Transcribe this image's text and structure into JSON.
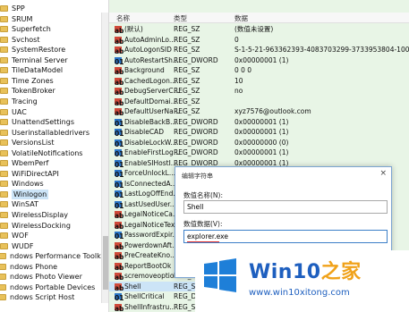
{
  "tree": {
    "items": [
      {
        "label": "SPP",
        "selected": false
      },
      {
        "label": "SRUM",
        "selected": false
      },
      {
        "label": "Superfetch",
        "selected": false
      },
      {
        "label": "Svchost",
        "selected": false
      },
      {
        "label": "SystemRestore",
        "selected": false
      },
      {
        "label": "Terminal Server",
        "selected": false
      },
      {
        "label": "TileDataModel",
        "selected": false
      },
      {
        "label": "Time Zones",
        "selected": false
      },
      {
        "label": "TokenBroker",
        "selected": false
      },
      {
        "label": "Tracing",
        "selected": false
      },
      {
        "label": "UAC",
        "selected": false
      },
      {
        "label": "UnattendSettings",
        "selected": false
      },
      {
        "label": "Userinstallabledrivers",
        "selected": false
      },
      {
        "label": "VersionsList",
        "selected": false
      },
      {
        "label": "VolatileNotifications",
        "selected": false
      },
      {
        "label": "WbemPerf",
        "selected": false
      },
      {
        "label": "WiFiDirectAPI",
        "selected": false
      },
      {
        "label": "Windows",
        "selected": false
      },
      {
        "label": "Winlogon",
        "selected": true
      },
      {
        "label": "WinSAT",
        "selected": false
      },
      {
        "label": "WirelessDisplay",
        "selected": false
      },
      {
        "label": "WirelessDocking",
        "selected": false
      },
      {
        "label": "WOF",
        "selected": false
      },
      {
        "label": "WUDF",
        "selected": false
      },
      {
        "label": "ndows Performance Toolkit",
        "selected": false
      },
      {
        "label": "ndows Phone",
        "selected": false
      },
      {
        "label": "ndows Photo Viewer",
        "selected": false
      },
      {
        "label": "ndows Portable Devices",
        "selected": false
      },
      {
        "label": "ndows Script Host",
        "selected": false
      }
    ]
  },
  "list": {
    "columns": {
      "name": "名称",
      "type": "类型",
      "data": "数据"
    },
    "rows": [
      {
        "name": "(默认)",
        "type": "REG_SZ",
        "data": "(数值未设置)",
        "icon": "ab"
      },
      {
        "name": "AutoAdminLo...",
        "type": "REG_SZ",
        "data": "0",
        "icon": "ab"
      },
      {
        "name": "AutoLogonSID",
        "type": "REG_SZ",
        "data": "S-1-5-21-963362393-4083703299-3733953804-1001",
        "icon": "ab"
      },
      {
        "name": "AutoRestartSh...",
        "type": "REG_DWORD",
        "data": "0x00000001 (1)",
        "icon": "bin"
      },
      {
        "name": "Background",
        "type": "REG_SZ",
        "data": "0 0 0",
        "icon": "ab"
      },
      {
        "name": "CachedLogon...",
        "type": "REG_SZ",
        "data": "10",
        "icon": "ab"
      },
      {
        "name": "DebugServerC...",
        "type": "REG_SZ",
        "data": "no",
        "icon": "ab"
      },
      {
        "name": "DefaultDomai...",
        "type": "REG_SZ",
        "data": "",
        "icon": "ab"
      },
      {
        "name": "DefaultUserNa...",
        "type": "REG_SZ",
        "data": "xyz7576@outlook.com",
        "icon": "ab"
      },
      {
        "name": "DisableBackB...",
        "type": "REG_DWORD",
        "data": "0x00000001 (1)",
        "icon": "bin"
      },
      {
        "name": "DisableCAD",
        "type": "REG_DWORD",
        "data": "0x00000001 (1)",
        "icon": "bin"
      },
      {
        "name": "DisableLockW...",
        "type": "REG_DWORD",
        "data": "0x00000000 (0)",
        "icon": "bin"
      },
      {
        "name": "EnableFirstLog...",
        "type": "REG_DWORD",
        "data": "0x00000001 (1)",
        "icon": "bin"
      },
      {
        "name": "EnableSIHostI...",
        "type": "REG_DWORD",
        "data": "0x00000001 (1)",
        "icon": "bin"
      },
      {
        "name": "ForceUnlockL...",
        "type": "",
        "data": "",
        "icon": "bin"
      },
      {
        "name": "IsConnectedA...",
        "type": "",
        "data": "",
        "icon": "bin"
      },
      {
        "name": "LastLogOffEnd...",
        "type": "",
        "data": "",
        "icon": "bin"
      },
      {
        "name": "LastUsedUser...",
        "type": "",
        "data": "",
        "icon": "bin"
      },
      {
        "name": "LegalNoticeCa...",
        "type": "",
        "data": "",
        "icon": "ab"
      },
      {
        "name": "LegalNoticeText",
        "type": "",
        "data": "",
        "icon": "ab"
      },
      {
        "name": "PasswordExpir...",
        "type": "",
        "data": "",
        "icon": "bin"
      },
      {
        "name": "PowerdownAft...",
        "type": "",
        "data": "",
        "icon": "ab"
      },
      {
        "name": "PreCreateKno...",
        "type": "",
        "data": "",
        "icon": "ab"
      },
      {
        "name": "ReportBootOk",
        "type": "",
        "data": "",
        "icon": "ab"
      },
      {
        "name": "scremoveoption",
        "type": "REG_SZ",
        "data": "",
        "icon": "ab"
      },
      {
        "name": "Shell",
        "type": "REG_SZ",
        "data": "",
        "icon": "ab"
      },
      {
        "name": "ShellCritical",
        "type": "REG_DW",
        "data": "",
        "icon": "bin"
      },
      {
        "name": "ShellInfrastru...",
        "type": "REG_SZ",
        "data": "",
        "icon": "ab"
      }
    ]
  },
  "dialog": {
    "title": "编辑字符串",
    "close": "×",
    "name_label": "数值名称(N):",
    "name_value": "Shell",
    "data_label": "数值数据(V):",
    "data_value": "explorer.exe"
  },
  "watermark": {
    "title_prefix": "Win10",
    "title_suffix": "之家",
    "url": "www.win10xitong.com",
    "colors": {
      "blue": "#1e5fbf",
      "orange": "#f0a21a"
    }
  }
}
